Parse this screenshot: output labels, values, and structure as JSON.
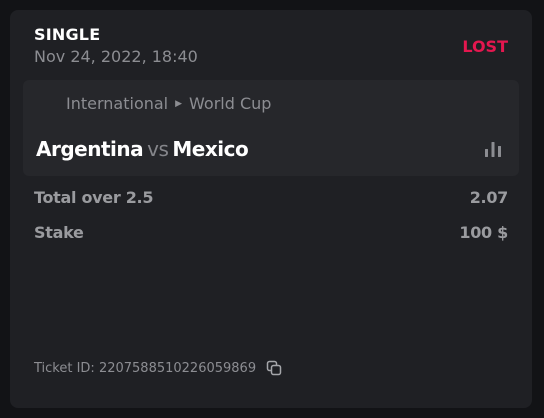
{
  "bet": {
    "type": "SINGLE",
    "date": "Nov 24, 2022, 18:40",
    "status": "LOST",
    "status_color": "#e4174f"
  },
  "event": {
    "category": "International",
    "league": "World Cup",
    "home_team": "Argentina",
    "vs": "vs",
    "away_team": "Mexico",
    "stats_icon": "bar-chart-icon"
  },
  "market": {
    "label": "Total over 2.5",
    "odds": "2.07"
  },
  "stake": {
    "label": "Stake",
    "value": "100 $"
  },
  "ticket": {
    "text": "Ticket ID: 2207588510226059869",
    "copy_icon": "copy-icon"
  }
}
